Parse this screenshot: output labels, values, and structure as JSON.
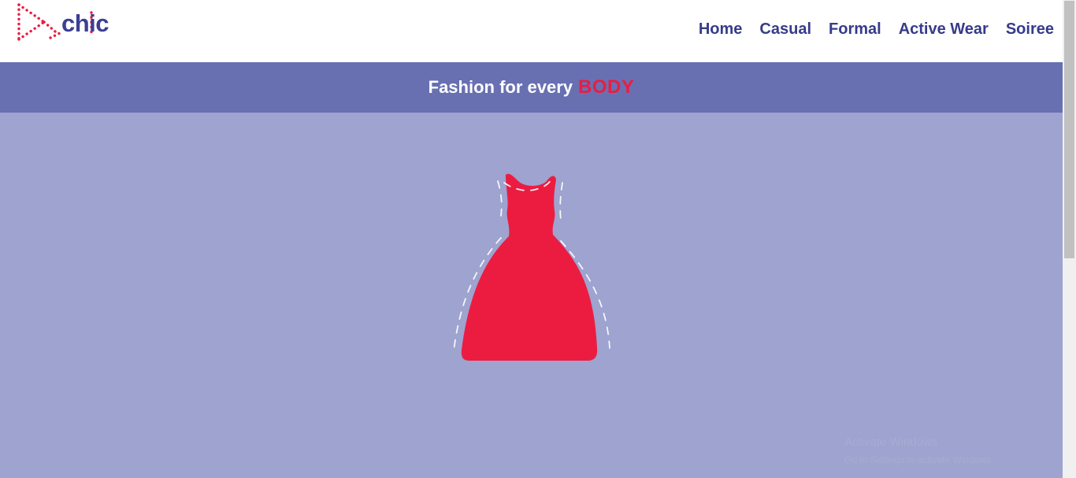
{
  "brand": {
    "name": "chic",
    "logo_color": "#ec1c41",
    "text_color": "#3b3f93"
  },
  "nav": {
    "items": [
      {
        "label": "Home"
      },
      {
        "label": "Casual"
      },
      {
        "label": "Formal"
      },
      {
        "label": "Active Wear"
      },
      {
        "label": "Soiree"
      }
    ]
  },
  "banner": {
    "text": "Fashion for every",
    "accent": "BODY"
  },
  "hero": {
    "image": "red-dress-icon"
  },
  "overlay": {
    "line1": "Activate Windows",
    "line2": "Go to Settings to activate Windows."
  },
  "colors": {
    "header_bg": "#ffffff",
    "banner_bg": "#6870b2",
    "hero_bg": "#9ea3cf",
    "accent": "#ec1c41"
  }
}
